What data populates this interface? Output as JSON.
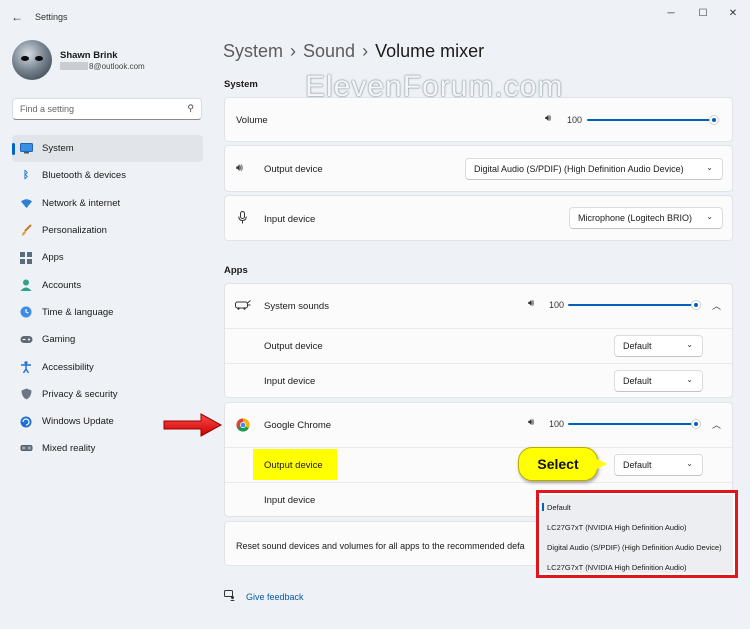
{
  "window": {
    "app_title": "Settings",
    "back_icon": "arrow-left-icon",
    "minimize_icon": "minimize-icon",
    "maximize_icon": "maximize-icon",
    "close_icon": "close-icon"
  },
  "profile": {
    "name": "Shawn Brink",
    "email": "8@outlook.com"
  },
  "search": {
    "placeholder": "Find a setting",
    "icon": "search-icon"
  },
  "sidebar": {
    "items": [
      {
        "label": "System",
        "icon": "monitor-icon",
        "active": true
      },
      {
        "label": "Bluetooth & devices",
        "icon": "bluetooth-icon"
      },
      {
        "label": "Network & internet",
        "icon": "wifi-icon"
      },
      {
        "label": "Personalization",
        "icon": "brush-icon"
      },
      {
        "label": "Apps",
        "icon": "apps-icon"
      },
      {
        "label": "Accounts",
        "icon": "person-icon"
      },
      {
        "label": "Time & language",
        "icon": "globe-clock-icon"
      },
      {
        "label": "Gaming",
        "icon": "gamepad-icon"
      },
      {
        "label": "Accessibility",
        "icon": "accessibility-icon"
      },
      {
        "label": "Privacy & security",
        "icon": "shield-icon"
      },
      {
        "label": "Windows Update",
        "icon": "update-icon"
      },
      {
        "label": "Mixed reality",
        "icon": "headset-icon"
      }
    ]
  },
  "breadcrumb": {
    "items": [
      "System",
      "Sound"
    ],
    "current": "Volume mixer",
    "separator": "›"
  },
  "watermark": "ElevenForum.com",
  "system_section": {
    "label": "System",
    "volume": {
      "label": "Volume",
      "value": "100",
      "level": 1.0
    },
    "output_device": {
      "label": "Output device",
      "value": "Digital Audio (S/PDIF) (High Definition Audio Device)"
    },
    "input_device": {
      "label": "Input device",
      "value": "Microphone (Logitech BRIO)"
    }
  },
  "apps_section": {
    "label": "Apps",
    "system_sounds": {
      "label": "System sounds",
      "volume": "100",
      "level": 1.0,
      "output_label": "Output device",
      "output_value": "Default",
      "input_label": "Input device",
      "input_value": "Default"
    },
    "chrome": {
      "label": "Google Chrome",
      "volume": "100",
      "level": 1.0,
      "output_label": "Output device",
      "output_value": "Default",
      "input_label": "Input device"
    }
  },
  "callout": {
    "text": "Select"
  },
  "flyout": {
    "options": [
      "Default",
      "LC27G7xT (NVIDIA High Definition Audio)",
      "Digital Audio (S/PDIF) (High Definition Audio Device)",
      "LC27G7xT (NVIDIA High Definition Audio)"
    ]
  },
  "reset": {
    "text": "Reset sound devices and volumes for all apps to the recommended defa"
  },
  "feedback": {
    "label": "Give feedback"
  },
  "colors": {
    "accent": "#005fb8",
    "highlight": "#ffff00",
    "annotation_red": "#e0161c"
  }
}
